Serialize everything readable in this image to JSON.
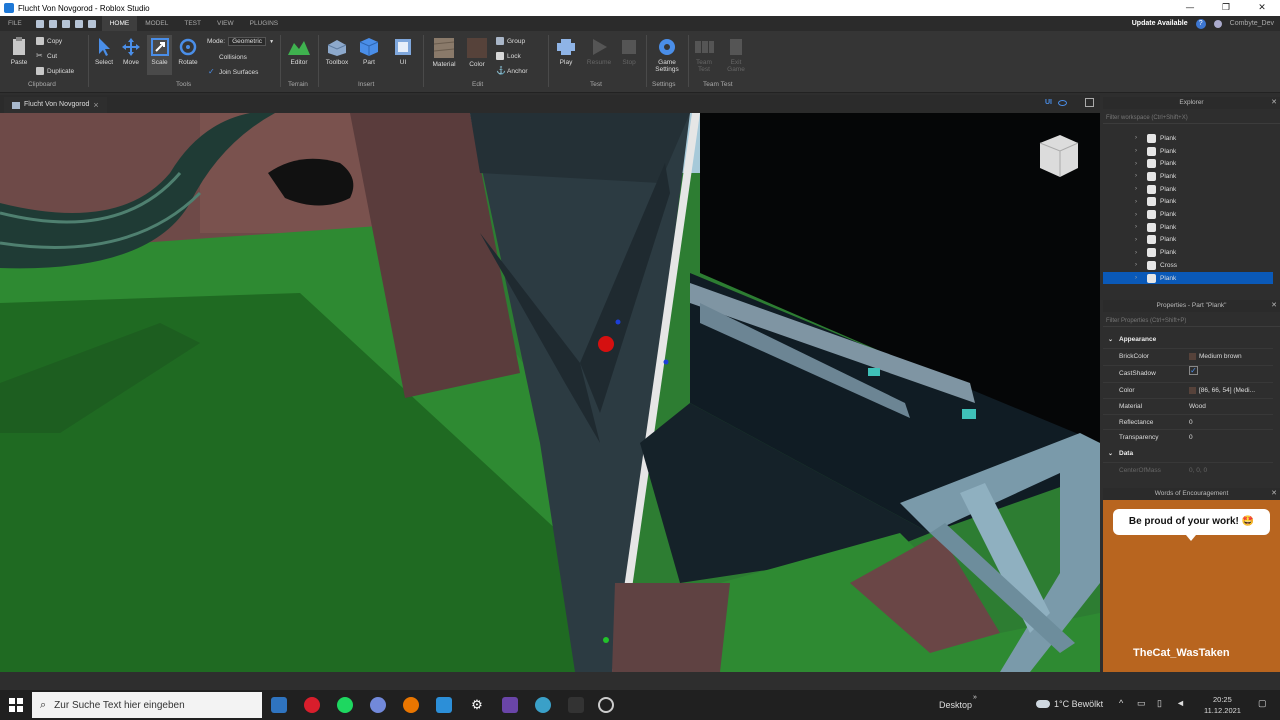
{
  "window": {
    "title": "Flucht Von Novgorod - Roblox Studio",
    "minimize": "—",
    "maximize": "❐",
    "close": "✕"
  },
  "menu": {
    "tabs": [
      "FILE",
      "HOME",
      "MODEL",
      "TEST",
      "VIEW",
      "PLUGINS"
    ],
    "active_tab": "HOME",
    "update_label": "Update Available",
    "help_icon": "?",
    "user": "Combyte_Dev"
  },
  "ribbon": {
    "clipboard": {
      "paste": "Paste",
      "copy": "Copy",
      "cut": "Cut",
      "duplicate": "Duplicate",
      "label": "Clipboard"
    },
    "tools": {
      "select": "Select",
      "move": "Move",
      "scale": "Scale",
      "rotate": "Rotate",
      "mode_label": "Mode:",
      "mode_value": "Geometric",
      "collisions": "Collisions",
      "join_surfaces": "Join Surfaces",
      "label": "Tools"
    },
    "terrain": {
      "editor": "Editor",
      "label": "Terrain"
    },
    "insert": {
      "toolbox": "Toolbox",
      "part": "Part",
      "ui": "UI",
      "label": "Insert"
    },
    "edit": {
      "material": "Material",
      "color": "Color",
      "group": "Group",
      "lock": "Lock",
      "anchor": "Anchor",
      "label": "Edit"
    },
    "test": {
      "play": "Play",
      "resume": "Resume",
      "stop": "Stop",
      "label": "Test"
    },
    "settings": {
      "game_settings_line1": "Game",
      "game_settings_line2": "Settings",
      "label": "Settings"
    },
    "team_test": {
      "team_line1": "Team",
      "team_line2": "Test",
      "exit_line1": "Exit",
      "exit_line2": "Game",
      "label": "Team Test"
    }
  },
  "doc_tab": {
    "title": "Flucht Von Novgorod",
    "close": "×"
  },
  "viewport_controls": {
    "ui_label": "UI"
  },
  "explorer": {
    "title": "Explorer",
    "filter_placeholder": "Filter workspace (Ctrl+Shift+X)",
    "items": [
      "Plank",
      "Plank",
      "Plank",
      "Plank",
      "Plank",
      "Plank",
      "Plank",
      "Plank",
      "Plank",
      "Plank",
      "Cross",
      "Plank"
    ],
    "selected_index": 11
  },
  "properties": {
    "title": "Properties - Part \"Plank\"",
    "filter_placeholder": "Filter Properties (Ctrl+Shift+P)",
    "section_appearance": "Appearance",
    "rows": [
      {
        "key": "BrickColor",
        "value": "Medium brown"
      },
      {
        "key": "CastShadow",
        "value": "✓"
      },
      {
        "key": "Color",
        "value": "[86, 66, 54] (Medi..."
      },
      {
        "key": "Material",
        "value": "Wood"
      },
      {
        "key": "Reflectance",
        "value": "0"
      },
      {
        "key": "Transparency",
        "value": "0"
      }
    ],
    "section_data": "Data",
    "data_row": {
      "key": "CenterOfMass",
      "value": "0, 0, 0"
    },
    "swatch_color": "#56423a"
  },
  "words": {
    "title": "Words of Encouragement",
    "message": "Be proud of your work! 🤩",
    "caption": "TheCat_WasTaken"
  },
  "taskbar": {
    "search_placeholder": "Zur Suche Text hier eingeben",
    "desktop_label": "Desktop",
    "weather": "1°C  Bewölkt",
    "time": "20:25",
    "date": "11.12.2021"
  },
  "colors": {
    "accent": "#0a59b8",
    "ribbon_bg": "#353535",
    "panel_bg": "#2e2e2e",
    "grass": "#2d7d32",
    "encouragement_bg": "#b8651f"
  }
}
